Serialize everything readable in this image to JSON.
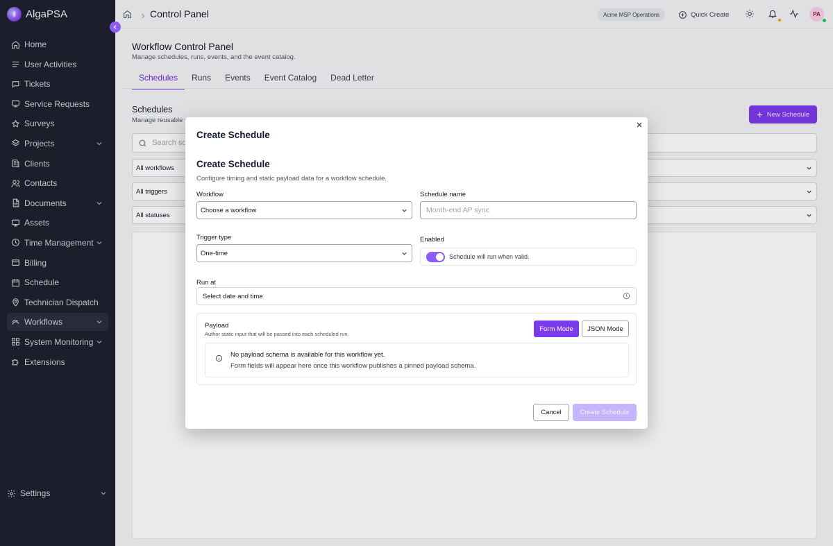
{
  "app": {
    "name": "AlgaPSA"
  },
  "sidebar": {
    "items": [
      {
        "label": "Home",
        "icon": "home-icon",
        "expandable": false
      },
      {
        "label": "User Activities",
        "icon": "activity-list-icon",
        "expandable": false
      },
      {
        "label": "Tickets",
        "icon": "ticket-icon",
        "expandable": false
      },
      {
        "label": "Service Requests",
        "icon": "service-requests-icon",
        "expandable": false
      },
      {
        "label": "Surveys",
        "icon": "star-icon",
        "expandable": false
      },
      {
        "label": "Projects",
        "icon": "layers-icon",
        "expandable": true
      },
      {
        "label": "Clients",
        "icon": "clients-icon",
        "expandable": false
      },
      {
        "label": "Contacts",
        "icon": "contacts-icon",
        "expandable": false
      },
      {
        "label": "Documents",
        "icon": "document-icon",
        "expandable": true
      },
      {
        "label": "Assets",
        "icon": "monitor-icon",
        "expandable": false
      },
      {
        "label": "Time Management",
        "icon": "clock-icon",
        "expandable": true
      },
      {
        "label": "Billing",
        "icon": "billing-icon",
        "expandable": false
      },
      {
        "label": "Schedule",
        "icon": "calendar-icon",
        "expandable": false
      },
      {
        "label": "Technician Dispatch",
        "icon": "map-pin-icon",
        "expandable": false
      },
      {
        "label": "Workflows",
        "icon": "workflow-icon",
        "expandable": true,
        "active": true
      },
      {
        "label": "System Monitoring",
        "icon": "grid-icon",
        "expandable": true
      },
      {
        "label": "Extensions",
        "icon": "puzzle-icon",
        "expandable": false
      }
    ],
    "settings_label": "Settings"
  },
  "header": {
    "breadcrumb_title": "Control Panel",
    "tenant": "Acme MSP Operations",
    "quick_create": "Quick Create",
    "avatar_initials": "PA"
  },
  "panel": {
    "title": "Workflow Control Panel",
    "subtitle": "Manage schedules, runs, events, and the event catalog.",
    "tabs": [
      {
        "label": "Schedules",
        "active": true
      },
      {
        "label": "Runs"
      },
      {
        "label": "Events"
      },
      {
        "label": "Event Catalog"
      },
      {
        "label": "Dead Letter"
      }
    ]
  },
  "schedules": {
    "title": "Schedules",
    "subtitle": "Manage reusable w",
    "new_button": "New Schedule",
    "search_placeholder": "Search sch",
    "filters": [
      "All workflows",
      "All triggers",
      "All statuses"
    ]
  },
  "modal": {
    "title": "Create Schedule",
    "form_title": "Create Schedule",
    "form_description": "Configure timing and static payload data for a workflow schedule.",
    "workflow_label": "Workflow",
    "workflow_value": "Choose a workflow",
    "schedule_name_label": "Schedule name",
    "schedule_name_placeholder": "Month-end AP sync",
    "trigger_type_label": "Trigger type",
    "trigger_type_value": "One-time",
    "enabled_label": "Enabled",
    "enabled": true,
    "enabled_text": "Schedule will run when valid.",
    "run_at_label": "Run at",
    "run_at_value": "Select date and time",
    "payload": {
      "title": "Payload",
      "subtitle": "Author static input that will be passed into each scheduled run.",
      "form_mode": "Form Mode",
      "json_mode": "JSON Mode",
      "notice_title": "No payload schema is available for this workflow yet.",
      "notice_body": "Form fields will appear here once this workflow publishes a pinned payload schema."
    },
    "cancel": "Cancel",
    "create": "Create Schedule"
  },
  "colors": {
    "sidebar_bg": "#1f2130",
    "accent": "#7c3aed",
    "accent_disabled": "#c4b5fd"
  }
}
